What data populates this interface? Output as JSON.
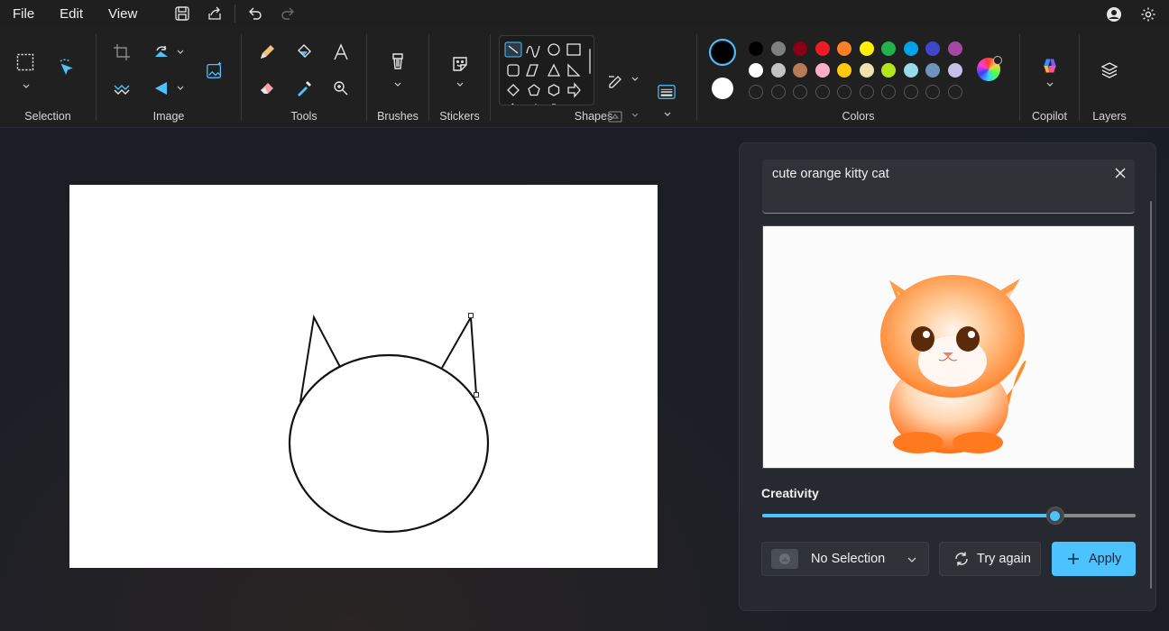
{
  "menu": {
    "file": "File",
    "edit": "Edit",
    "view": "View"
  },
  "ribbon": {
    "groups": {
      "selection": "Selection",
      "image": "Image",
      "tools": "Tools",
      "brushes": "Brushes",
      "stickers": "Stickers",
      "shapes": "Shapes",
      "colors": "Colors",
      "copilot": "Copilot",
      "layers": "Layers"
    },
    "palette_row1": [
      "#000000",
      "#7f7f7f",
      "#880015",
      "#ed1c24",
      "#ff7f27",
      "#fff200",
      "#22b14c",
      "#00a2e8",
      "#3f48cc",
      "#a349a4"
    ],
    "palette_row2": [
      "#ffffff",
      "#c3c3c3",
      "#b97a57",
      "#ffaec9",
      "#ffc90e",
      "#efe4b0",
      "#b5e61d",
      "#99d9ea",
      "#7092be",
      "#c8bfe7"
    ],
    "primary_color": "#000000",
    "secondary_color": "#ffffff"
  },
  "panel": {
    "prompt": "cute orange kitty cat",
    "creativity_label": "Creativity",
    "creativity_value": 0.785,
    "selection_dropdown": "No Selection",
    "try_again": "Try again",
    "apply": "Apply"
  }
}
